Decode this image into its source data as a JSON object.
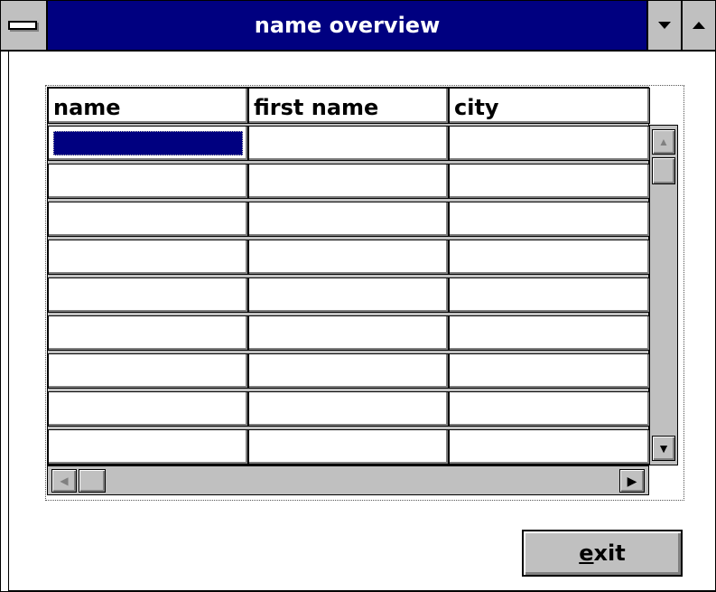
{
  "window": {
    "title": "name overview",
    "system_menu_icon": "system-menu-icon",
    "minimize_icon": "minimize-arrow-icon",
    "maximize_icon": "maximize-arrow-icon"
  },
  "grid": {
    "columns": [
      {
        "label": "name"
      },
      {
        "label": "first name"
      },
      {
        "label": "city"
      }
    ],
    "rows": [
      [
        "",
        "",
        ""
      ],
      [
        "",
        "",
        ""
      ],
      [
        "",
        "",
        ""
      ],
      [
        "",
        "",
        ""
      ],
      [
        "",
        "",
        ""
      ],
      [
        "",
        "",
        ""
      ],
      [
        "",
        "",
        ""
      ],
      [
        "",
        "",
        ""
      ],
      [
        "",
        "",
        ""
      ]
    ],
    "selected_cell": {
      "row": 1,
      "column": "name"
    }
  },
  "buttons": {
    "exit": {
      "mnemonic": "e",
      "rest": "xit"
    }
  },
  "colors": {
    "titlebar": "#000080",
    "face": "#c0c0c0",
    "selection": "#000080"
  }
}
